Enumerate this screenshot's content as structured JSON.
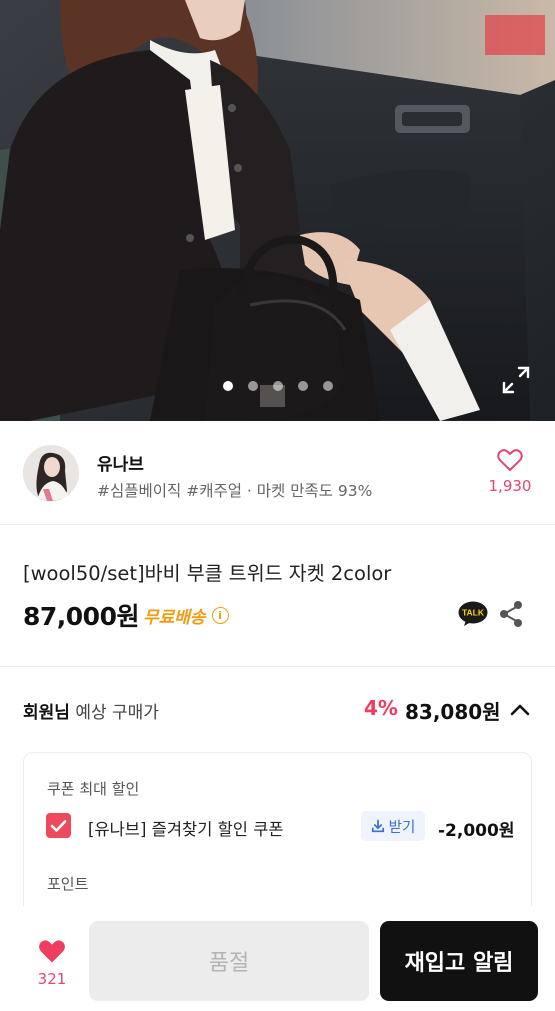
{
  "gallery": {
    "dots": [
      true,
      false,
      false,
      false,
      false
    ],
    "expand_icon": "expand-icon"
  },
  "shop": {
    "name": "유나브",
    "meta": "#심플베이직 #캐주얼 · 마켓 만족도 93%",
    "like_count": "1,930"
  },
  "product": {
    "title": "[wool50/set]바비 부클 트위드 자켓 2color",
    "price": "87,000원",
    "shipping": "무료배송",
    "info_glyph": "i"
  },
  "member_price": {
    "label_bold": "회원님",
    "label_rest": " 예상 구매가",
    "discount": "4%",
    "price": "83,080원"
  },
  "coupon": {
    "header": "쿠폰 최대 할인",
    "name": "[유나브] 즐겨찾기 할인 쿠폰",
    "receive_label": "받기",
    "amount": "-2,000원",
    "checked": true,
    "point_header": "포인트"
  },
  "bottom_bar": {
    "wish_count": "321",
    "soldout_label": "품절",
    "restock_label": "재입고 알림"
  },
  "colors": {
    "accent_red": "#ef3d5f",
    "heart_pink": "#e0476b",
    "shipping_orange": "#f39c12",
    "coupon_blue": "#3b6fd1"
  }
}
